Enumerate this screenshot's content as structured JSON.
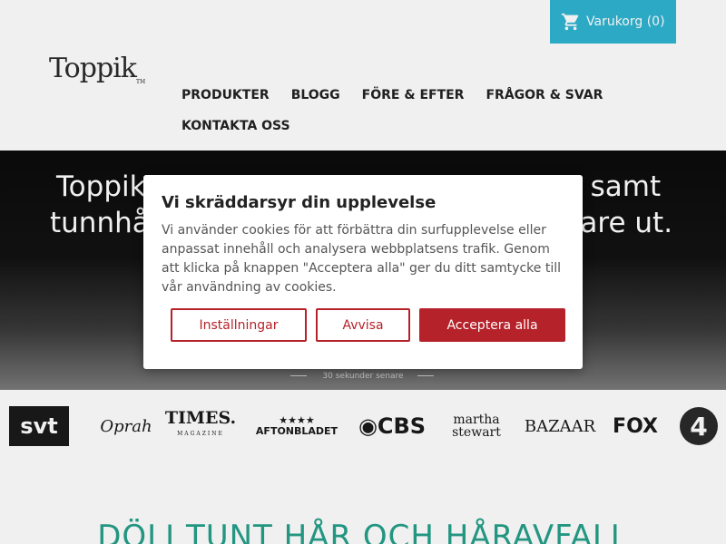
{
  "header": {
    "cart_label": "Varukorg (0)",
    "logo_text": "Toppik",
    "logo_tm": "TM",
    "nav": [
      "PRODUKTER",
      "BLOGG",
      "FÖRE & EFTER",
      "FRÅGOR & SVAR",
      "KONTAKTA OSS"
    ]
  },
  "hero": {
    "line1": "Toppik ... r samt",
    "line1_left": "Toppik",
    "line1_right": "r samt",
    "line2_left": "tunnhå",
    "line2_right": "kare ut.",
    "caption": "30 sekunder senare"
  },
  "media_logos": {
    "svt": "svt",
    "oprah": "Oprah",
    "times": "TIMES.",
    "times_sub": "MAGAZINE",
    "afton_stars": "★★★★",
    "afton": "AFTONBLADET",
    "cbs": "◉CBS",
    "martha1": "martha",
    "martha2": "stewart",
    "bazaar": "BAZAAR",
    "fox": "FOX",
    "tv4": "4"
  },
  "lower": {
    "headline": "DÖLJ TUNT HÅR OCH HÅRAVFALL"
  },
  "cookie_dialog": {
    "title": "Vi skräddarsyr din upplevelse",
    "body": "Vi använder cookies för att förbättra din surfupplevelse eller anpassat innehåll och analysera webbplatsens trafik. Genom att klicka på knappen \"Acceptera alla\" ger du ditt samtycke till vår användning av cookies.",
    "settings_label": "Inställningar",
    "reject_label": "Avvisa",
    "accept_label": "Acceptera alla"
  },
  "colors": {
    "cart_bg": "#2fb5d2",
    "accent_red": "#b5222a",
    "headline_green": "#25a08a"
  }
}
